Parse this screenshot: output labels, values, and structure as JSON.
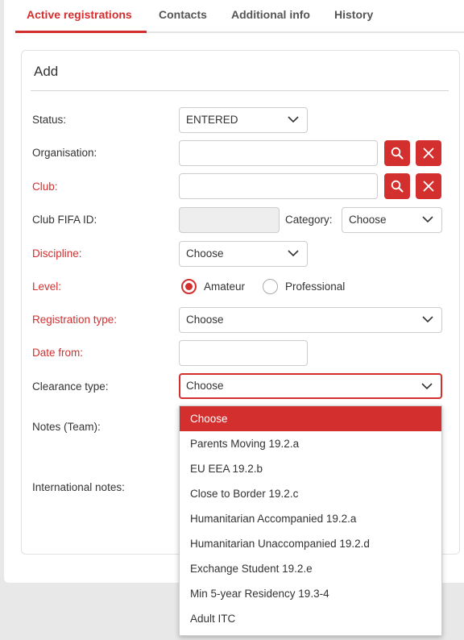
{
  "tabs": [
    {
      "label": "Active registrations"
    },
    {
      "label": "Contacts"
    },
    {
      "label": "Additional info"
    },
    {
      "label": "History"
    }
  ],
  "panel": {
    "title": "Add"
  },
  "form": {
    "status": {
      "label": "Status:",
      "value": "ENTERED"
    },
    "organisation": {
      "label": "Organisation:",
      "value": ""
    },
    "club": {
      "label": "Club:",
      "value": ""
    },
    "club_fifa_id": {
      "label": "Club FIFA ID:",
      "value": ""
    },
    "category": {
      "label": "Category:",
      "value": "Choose"
    },
    "discipline": {
      "label": "Discipline:",
      "value": "Choose"
    },
    "level": {
      "label": "Level:",
      "options": [
        "Amateur",
        "Professional"
      ],
      "selected": "Amateur"
    },
    "registration_type": {
      "label": "Registration type:",
      "value": "Choose"
    },
    "date_from": {
      "label": "Date from:",
      "value": ""
    },
    "clearance_type": {
      "label": "Clearance type:",
      "value": "Choose"
    },
    "notes_team": {
      "label": "Notes (Team):"
    },
    "international_notes": {
      "label": "International notes:"
    }
  },
  "clearance_dropdown": {
    "options": [
      "Choose",
      "Parents Moving 19.2.a",
      "EU EEA 19.2.b",
      "Close to Border 19.2.c",
      "Humanitarian Accompanied 19.2.a",
      "Humanitarian Unaccompanied 19.2.d",
      "Exchange Student 19.2.e",
      "Min 5-year Residency 19.3-4",
      "Adult ITC"
    ],
    "highlighted": "Choose"
  },
  "colors": {
    "accent": "#d32f2f",
    "border": "#cccccc",
    "text": "#333333"
  },
  "icons": {
    "search": "search-icon",
    "clear": "close-icon",
    "dropdown": "chevron-down-icon"
  }
}
